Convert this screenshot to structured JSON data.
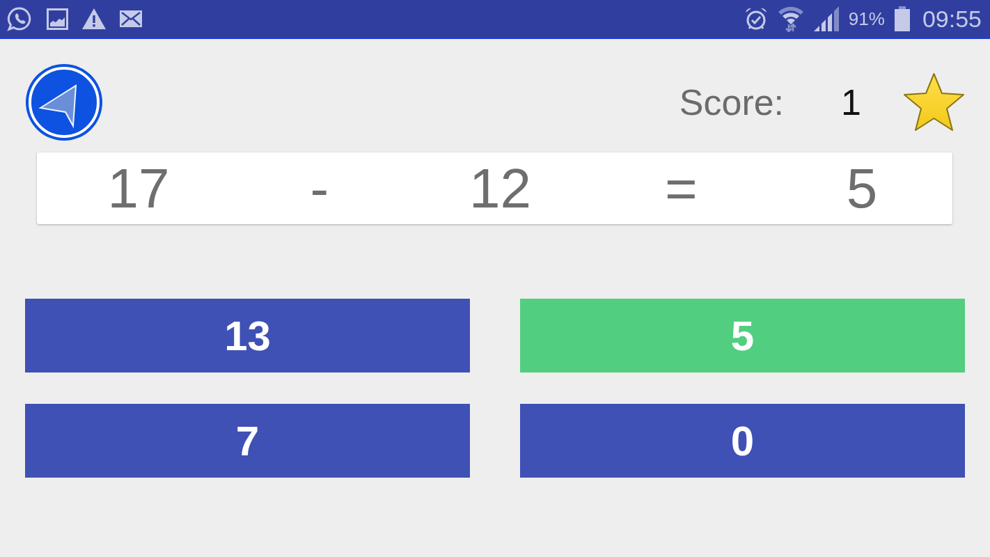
{
  "status_bar": {
    "battery": "91%",
    "time": "09:55"
  },
  "score": {
    "label": "Score:",
    "value": "1"
  },
  "equation": {
    "operand_1": "17",
    "operator": "-",
    "operand_2": "12",
    "equals": "=",
    "result": "5"
  },
  "answers": [
    {
      "label": "13",
      "selected": false
    },
    {
      "label": "5",
      "selected": true
    },
    {
      "label": "7",
      "selected": false
    },
    {
      "label": "0",
      "selected": false
    }
  ]
}
